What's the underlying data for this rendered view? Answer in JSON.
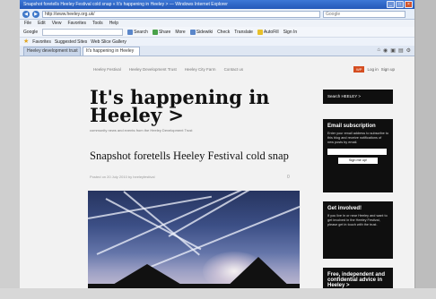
{
  "browser": {
    "title": "Snapshot foretells Heeley Festival cold snap « It's happening in Heeley > — Windows Internet Explorer",
    "url": "http://www.heeley.org.uk/",
    "search_placeholder": "Google",
    "window_controls": [
      "_",
      "□",
      "×"
    ],
    "nav": {
      "back_icon": "back-arrow-icon",
      "forward_icon": "forward-arrow-icon"
    },
    "menu": [
      "File",
      "Edit",
      "View",
      "Favorites",
      "Tools",
      "Help"
    ],
    "google_toolbar": {
      "label": "Google",
      "items": [
        "Search",
        "Share",
        "More",
        "Sidewiki",
        "Check",
        "Translate",
        "AutoFill",
        "Sign In"
      ]
    },
    "favorites": {
      "label": "Favorites",
      "items": [
        "Suggested Sites",
        "Web Slice Gallery"
      ]
    },
    "tabs": [
      {
        "label": "Heeley development trust",
        "active": false
      },
      {
        "label": "It's happening in Heeley",
        "active": true
      }
    ],
    "command_icons": [
      "home-icon",
      "feeds-icon",
      "print-icon",
      "page-icon",
      "tools-icon"
    ]
  },
  "site": {
    "nav": [
      "Heeley Festival",
      "Heeley Development Trust",
      "Heeley City Farm",
      "Contact us"
    ],
    "login_badge": "WP",
    "login_text": "Log in",
    "login_user": "Sign up",
    "title": "It's happening in Heeley >",
    "tagline": "community news and events from the Heeley Development Trust"
  },
  "post": {
    "title": "Snapshot foretells Heeley Festival cold snap",
    "meta": "Posted on 20 July 2010 by heeleyfestival",
    "comments": "0"
  },
  "sidebar": {
    "search_label": "Search HEELEY >",
    "email": {
      "heading": "Email subscription",
      "text": "Enter your email address to subscribe to this blog and receive notifications of new posts by email.",
      "button": "Sign me up!"
    },
    "involved": {
      "heading": "Get involved!",
      "text": "If you live in or near Heeley and want to get involved in the Heeley Festival, please get in touch with the trust."
    },
    "advice": {
      "heading": "Free, independent and confidential advice in Heeley >"
    }
  }
}
